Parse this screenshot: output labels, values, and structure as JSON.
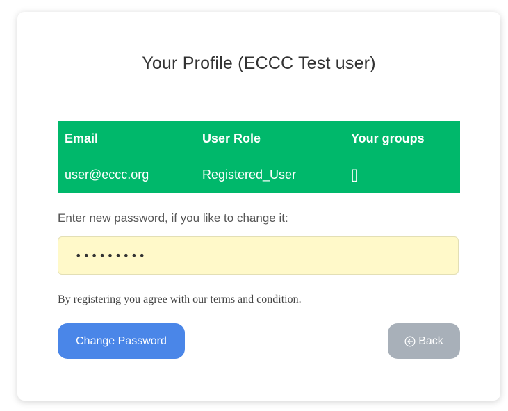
{
  "profile": {
    "title": "Your Profile (ECCC Test user)",
    "table": {
      "headers": [
        "Email",
        "User Role",
        "Your groups"
      ],
      "row": [
        "user@eccc.org",
        "Registered_User",
        "[]"
      ]
    },
    "password_prompt": "Enter new password, if you like to change it:",
    "password_value": "•••••••••",
    "terms_text": "By registering you agree with our terms and condition.",
    "change_password_label": "Change Password",
    "back_label": "Back",
    "icons": {
      "back": "back-arrow-circle-icon"
    },
    "colors": {
      "table_bg": "#00b86b",
      "password_bg": "#fff9c9",
      "primary_button": "#4a86e8",
      "secondary_button": "#a8b0b9"
    }
  }
}
